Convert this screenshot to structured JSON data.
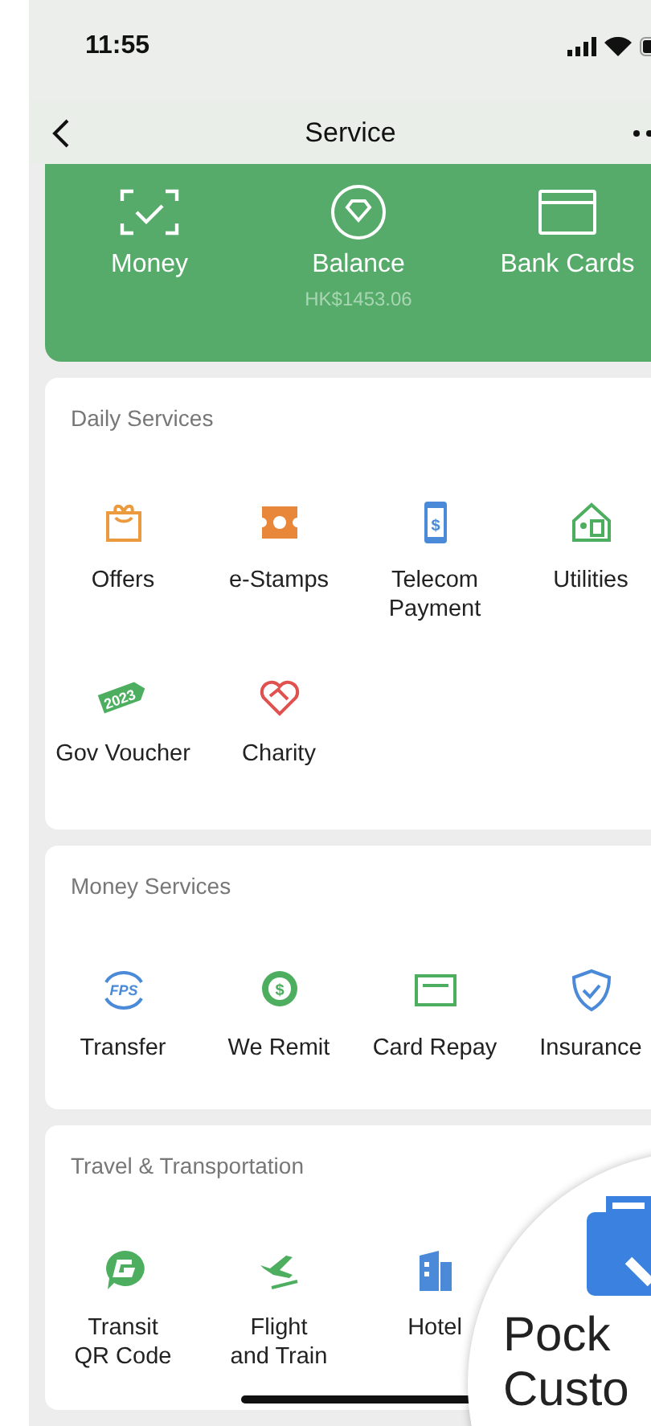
{
  "status_bar": {
    "time": "11:55"
  },
  "nav": {
    "title": "Service"
  },
  "wallet": [
    {
      "label": "Money",
      "kind": "scan"
    },
    {
      "label": "Balance",
      "kind": "diamond",
      "sublabel": "HK$1453.06"
    },
    {
      "label": "Bank Cards",
      "kind": "card"
    }
  ],
  "sections": [
    {
      "title": "Daily Services",
      "items": [
        {
          "label": "Offers",
          "kind": "gift"
        },
        {
          "label": "e-Stamps",
          "kind": "stamp"
        },
        {
          "label": "Telecom\nPayment",
          "kind": "phone",
          "badge": "$"
        },
        {
          "label": "Utilities",
          "kind": "house"
        },
        {
          "label": "Gov Voucher",
          "kind": "tag",
          "badge": "2023"
        },
        {
          "label": "Charity",
          "kind": "heart"
        }
      ]
    },
    {
      "title": "Money Services",
      "items": [
        {
          "label": "Transfer",
          "kind": "fps",
          "badge": "FPS"
        },
        {
          "label": "We Remit",
          "kind": "remit",
          "badge": "$"
        },
        {
          "label": "Card Repay",
          "kind": "repay"
        },
        {
          "label": "Insurance",
          "kind": "shield"
        }
      ]
    },
    {
      "title": "Travel & Transportation",
      "items": [
        {
          "label": "Transit\nQR Code",
          "kind": "transit"
        },
        {
          "label": "Flight\nand Train",
          "kind": "plane"
        },
        {
          "label": "Hotel",
          "kind": "hotel"
        }
      ]
    }
  ],
  "magnifier": {
    "lines": [
      "Pock",
      "Custo"
    ]
  }
}
